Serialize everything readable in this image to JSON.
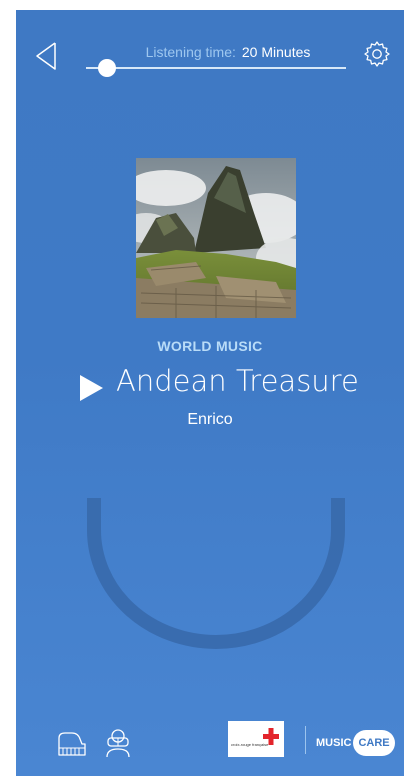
{
  "header": {
    "listening_label": "Listening time:",
    "listening_value": "20 Minutes",
    "listening_progress": 0.08
  },
  "track": {
    "genre": "WORLD MUSIC",
    "title": "Andean Treasure",
    "artist": "Enrico"
  },
  "footer": {
    "partner_logo_text": "croix-rouge française",
    "brand_music": "MUSIC",
    "brand_care": "CARE"
  },
  "colors": {
    "background": "#3f79c4",
    "genre": "#b9dcf8",
    "listening_label": "#9ec7ef",
    "red_cross": "#e3242b"
  },
  "icons": [
    "back-arrow-icon",
    "gear-icon",
    "play-icon",
    "piano-icon",
    "vr-headset-icon",
    "red-cross-icon"
  ]
}
